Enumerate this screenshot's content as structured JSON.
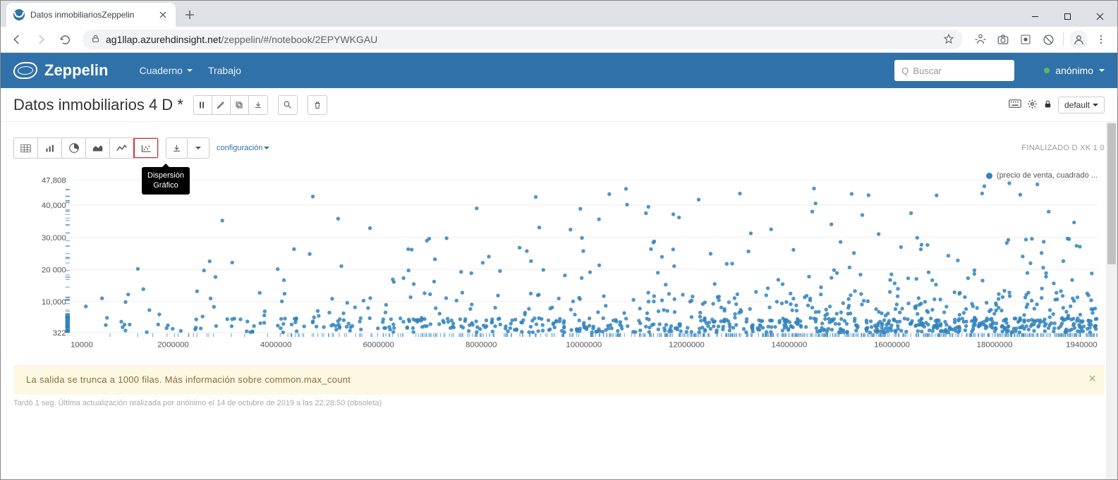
{
  "browser": {
    "tab_title": "Datos inmobiliariosZeppelin",
    "url_host": "ag1llap.azurehdinsight.net",
    "url_path": "/zeppelin/#/notebook/2EPYWKGAU"
  },
  "zeppelin": {
    "brand": "Zeppelin",
    "nav": {
      "notebook": "Cuaderno",
      "job": "Trabajo"
    },
    "search_placeholder": "Buscar",
    "user": "anónimo"
  },
  "notebook": {
    "title": "Datos inmobiliarios 4 D *",
    "default_label": "default"
  },
  "paragraph": {
    "status": "FINALIZADO D XK 1 0",
    "config_label": "configuración",
    "tooltip_line1": "Dispersión",
    "tooltip_line2": "Gráfico",
    "legend": "(precio de venta, cuadrado ...",
    "alert": "La salida se trunca a 1000 filas. Más información sobre common.max_count",
    "footer": "Tardó 1 seg. Última actualización realizada por anónimo el 14 de octubre de 2019 a las 22:28:50 (obsoleta)"
  },
  "chart_data": {
    "type": "scatter",
    "title": "",
    "xlabel": "",
    "ylabel": "",
    "xlim": [
      10000,
      1940000
    ],
    "ylim": [
      322,
      47808
    ],
    "x_ticks": [
      10000,
      2000000,
      4000000,
      6000000,
      8000000,
      10000000,
      12000000,
      14000000,
      16000000,
      18000000,
      1940000
    ],
    "x_tick_labels": [
      "10000",
      "2000000",
      "4000000",
      "6000000",
      "8000000",
      "10000000",
      "12000000",
      "14000000",
      "16000000",
      "18000000",
      "1940000"
    ],
    "y_ticks": [
      322,
      10000,
      20000,
      30000,
      40000,
      47808
    ],
    "y_tick_labels": [
      "322",
      "10,000",
      "20 000",
      "30,000",
      "40,000",
      "47,808"
    ],
    "series": [
      {
        "name": "(precio de venta, cuadrado ...",
        "note": "approx 1000 points, dense low-y band with outliers up to ~47k; values estimated from pixels"
      }
    ]
  }
}
